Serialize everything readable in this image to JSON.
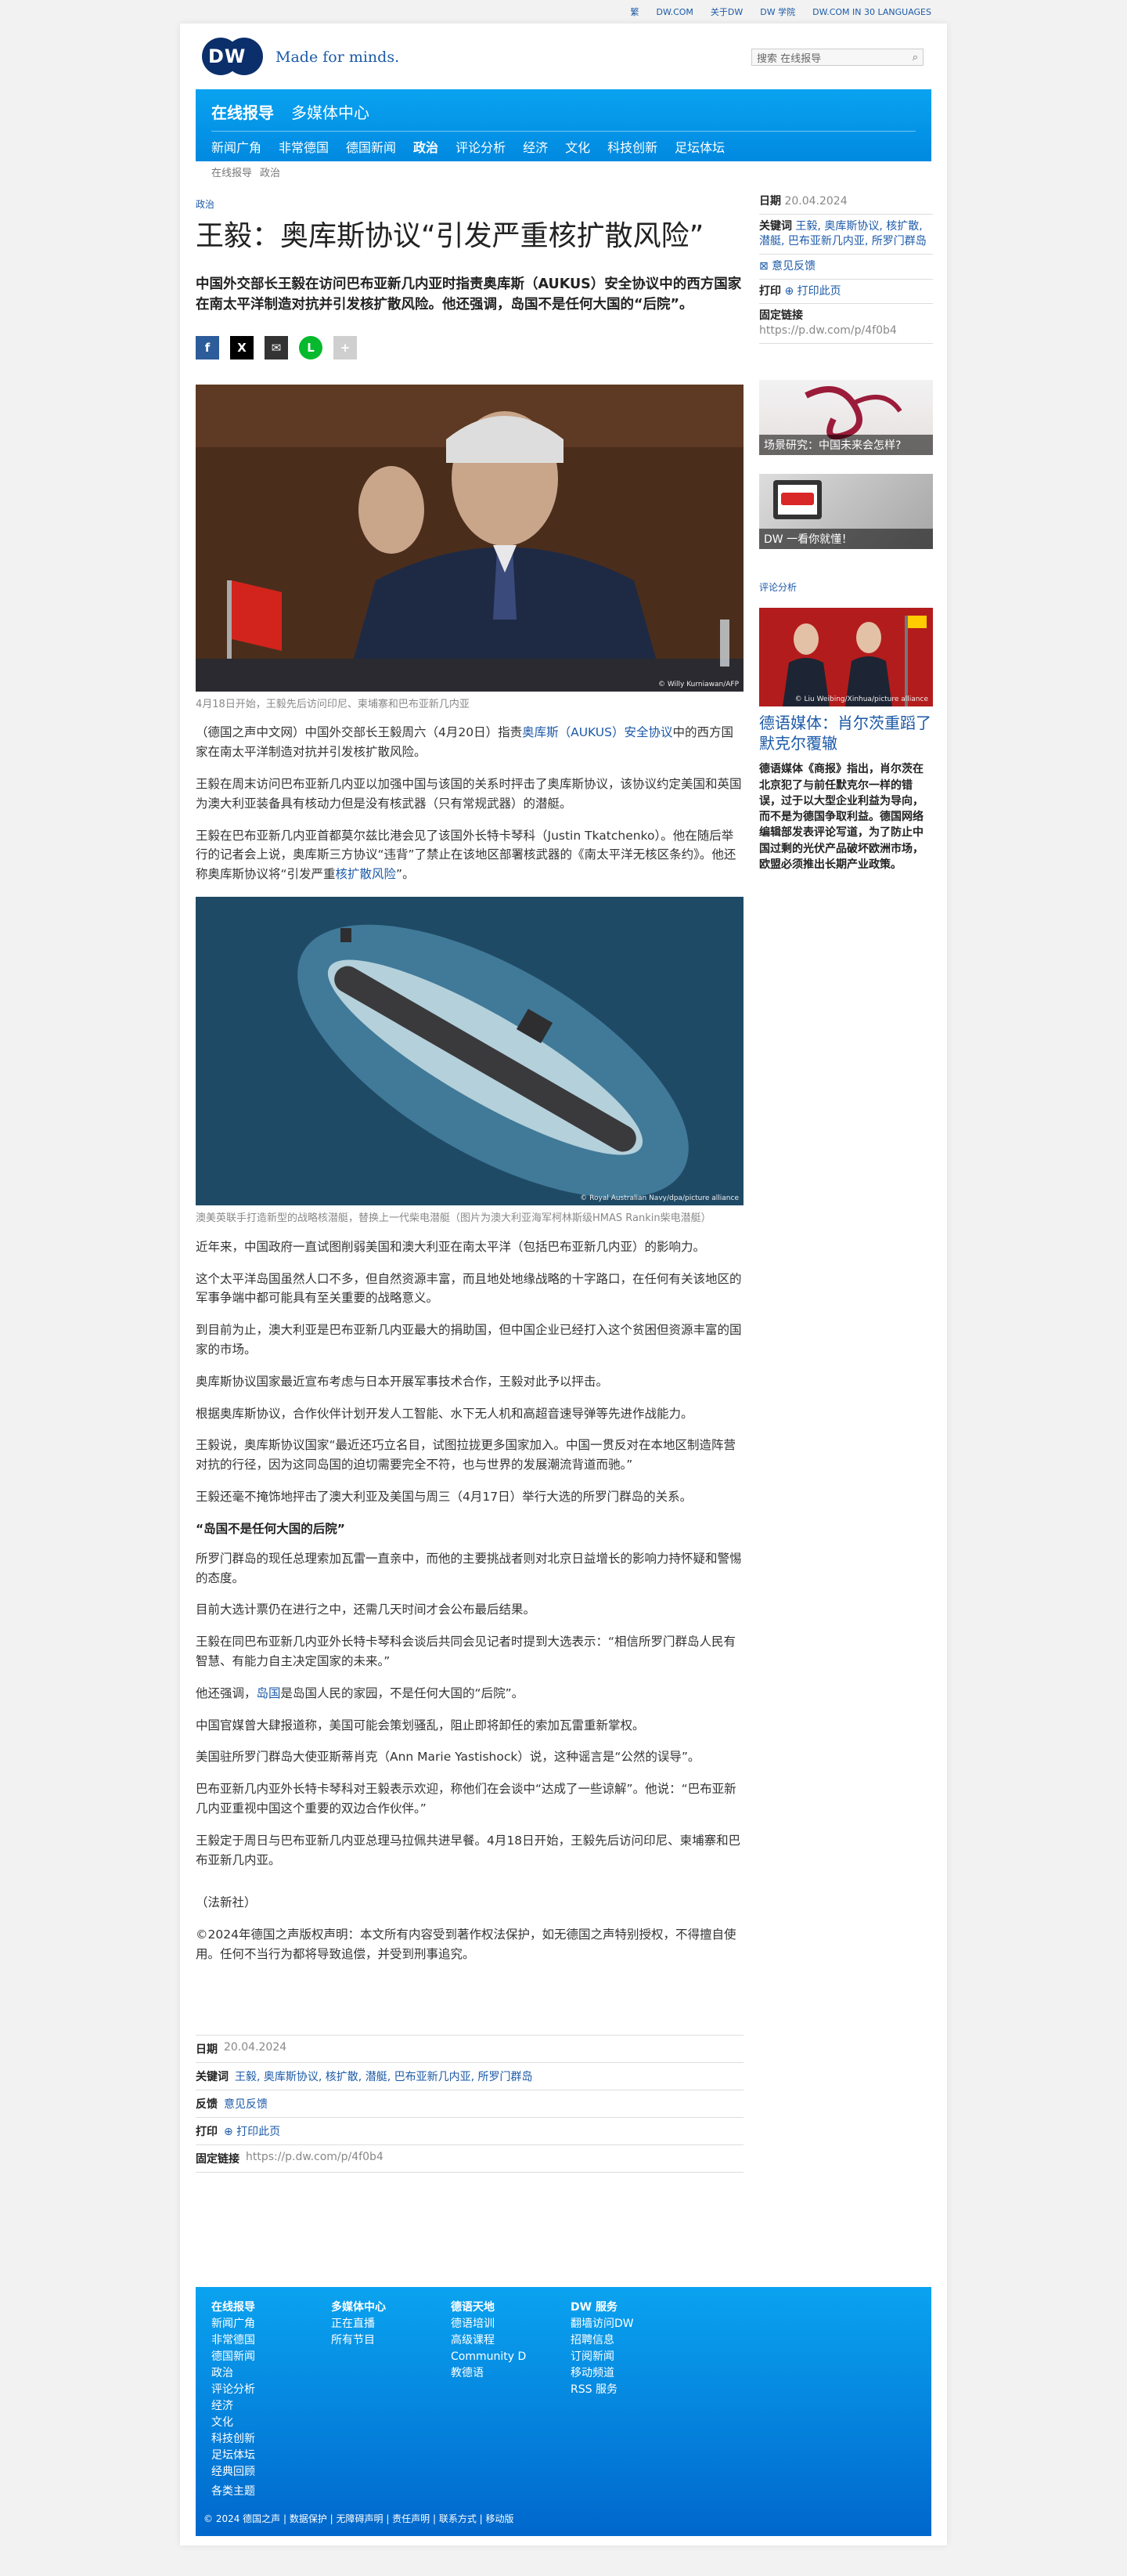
{
  "topbar": {
    "links": [
      "繁",
      "DW.COM",
      "关于DW",
      "DW 学院",
      "DW.COM IN 30 LANGUAGES"
    ]
  },
  "header": {
    "logo_text": "DW",
    "tagline": "Made for minds.",
    "search_placeholder": "搜索 在线报导"
  },
  "nav": {
    "main": [
      "在线报导",
      "多媒体中心"
    ],
    "sub": [
      "新闻广角",
      "非常德国",
      "德国新闻",
      "政治",
      "评论分析",
      "经济",
      "文化",
      "科技创新",
      "足坛体坛"
    ]
  },
  "breadcrumb": [
    "在线报导",
    "政治"
  ],
  "article": {
    "category": "政治",
    "title": "王毅：奥库斯协议“引发严重核扩散风险”",
    "lede": "中国外交部长王毅在访问巴布亚新几内亚时指责奥库斯（AUKUS）安全协议中的西方国家在南太平洋制造对抗并引发核扩散风险。他还强调，岛国不是任何大国的“后院”。",
    "share": [
      "f",
      "X",
      "✉",
      "L",
      "+"
    ],
    "image1_credit": "© Willy Kurniawan/AFP",
    "caption1": "4月18日开始，王毅先后访问印尼、柬埔寨和巴布亚新几内亚",
    "p1_a": "（德国之声中文网）中国外交部长王毅周六（4月20日）指责",
    "p1_link": "奥库斯（AUKUS）安全协议",
    "p1_b": "中的西方国家在南太平洋制造对抗并引发核扩散风险。",
    "p2": "王毅在周末访问巴布亚新几内亚以加强中国与该国的关系时抨击了奥库斯协议，该协议约定美国和英国为澳大利亚装备具有核动力但是没有核武器（只有常规武器）的潜艇。",
    "p3_a": "王毅在巴布亚新几内亚首都莫尔兹比港会见了该国外长特卡琴科（Justin Tkatchenko）。他在随后举行的记者会上说，奥库斯三方协议“违背”了禁止在该地区部署核武器的《南太平洋无核区条约》。他还称奥库斯协议将“引发严重",
    "p3_link": "核扩散风险",
    "p3_b": "”。",
    "image2_credit": "© Royal Australian Navy/dpa/picture alliance",
    "caption2": "澳美英联手打造新型的战略核潜艇，替换上一代柴电潜艇（图片为澳大利亚海军柯林斯级HMAS Rankin柴电潜艇）",
    "p4": "近年来，中国政府一直试图削弱美国和澳大利亚在南太平洋（包括巴布亚新几内亚）的影响力。",
    "p5": "这个太平洋岛国虽然人口不多，但自然资源丰富，而且地处地缘战略的十字路口，在任何有关该地区的军事争端中都可能具有至关重要的战略意义。",
    "p6": "到目前为止，澳大利亚是巴布亚新几内亚最大的捐助国，但中国企业已经打入这个贫困但资源丰富的国家的市场。",
    "p7": "奥库斯协议国家最近宣布考虑与日本开展军事技术合作，王毅对此予以抨击。",
    "p8": "根据奥库斯协议，合作伙伴计划开发人工智能、水下无人机和高超音速导弹等先进作战能力。",
    "p9": "王毅说，奥库斯协议国家“最近还巧立名目，试图拉拢更多国家加入。中国一贯反对在本地区制造阵营对抗的行径，因为这同岛国的迫切需要完全不符，也与世界的发展潮流背道而驰。”",
    "p10": "王毅还毫不掩饰地抨击了澳大利亚及美国与周三（4月17日）举行大选的所罗门群岛的关系。",
    "subhead": "“岛国不是任何大国的后院”",
    "p11": "所罗门群岛的现任总理索加瓦雷一直亲中，而他的主要挑战者则对北京日益增长的影响力持怀疑和警惕的态度。",
    "p12": "目前大选计票仍在进行之中，还需几天时间才会公布最后结果。",
    "p13": "王毅在同巴布亚新几内亚外长特卡琴科会谈后共同会见记者时提到大选表示：“相信所罗门群岛人民有智慧、有能力自主决定国家的未来。”",
    "p14_a": "他还强调，",
    "p14_link": "岛国",
    "p14_b": "是岛国人民的家园，不是任何大国的“后院”。",
    "p15": "中国官媒曾大肆报道称，美国可能会策划骚乱，阻止即将卸任的索加瓦雷重新掌权。",
    "p16": "美国驻所罗门群岛大使亚斯蒂肖克（Ann Marie Yastishock）说，这种谣言是“公然的误导”。",
    "p17": "巴布亚新几内亚外长特卡琴科对王毅表示欢迎，称他们在会谈中“达成了一些谅解”。他说：“巴布亚新几内亚重视中国这个重要的双边合作伙伴。”",
    "p18": "王毅定于周日与巴布亚新几内亚总理马拉佩共进早餐。4月18日开始，王毅先后访问印尼、柬埔寨和巴布亚新几内亚。",
    "source": "（法新社）",
    "copyright": "©2024年德国之声版权声明：本文所有内容受到著作权法保护，如无德国之声特别授权，不得擅自使用。任何不当行为都将导致追偿，并受到刑事追究。"
  },
  "meta": {
    "date_label": "日期",
    "date": "20.04.2024",
    "keywords_label": "关键词",
    "keywords": "王毅, 奥库斯协议, 核扩散, 潜艇, 巴布亚新几内亚, 所罗门群岛",
    "feedback_label": "反馈",
    "feedback": "意见反馈",
    "print_label": "打印",
    "print": "⊕ 打印此页",
    "permalink_label": "固定链接",
    "permalink": "https://p.dw.com/p/4f0b4"
  },
  "sidebar": {
    "feedback_link": "⊠ 意见反馈",
    "teaser1": "场景研究：中国未来会怎样?",
    "teaser2": "DW 一看你就懂！",
    "section": "评论分析",
    "t3_credit": "© Liu Weibing/Xinhua/picture alliance",
    "title": "德语媒体：肖尔茨重蹈了默克尔覆辙",
    "text": "德语媒体《商报》指出，肖尔茨在北京犯了与前任默克尔一样的错误，过于以大型企业利益为导向，而不是为德国争取利益。德国网络编辑部发表评论写道，为了防止中国过剩的光伏产品破坏欧洲市场，欧盟必须推出长期产业政策。"
  },
  "footer": {
    "col1_head": "在线报导",
    "col1": [
      "新闻广角",
      "非常德国",
      "德国新闻",
      "政治",
      "评论分析",
      "经济",
      "文化",
      "科技创新",
      "足坛体坛",
      "经典回顾"
    ],
    "col2_head": "多媒体中心",
    "col2": [
      "正在直播",
      "所有节目"
    ],
    "col3_head": "德语天地",
    "col3": [
      "德语培训",
      "高级课程",
      "Community D",
      "教德语"
    ],
    "col4_head": "DW 服务",
    "col4": [
      "翻墙访问DW",
      "招聘信息",
      "订阅新闻",
      "移动频道",
      "RSS 服务"
    ],
    "topics": "各类主题",
    "copyright": "© 2024 德国之声 | 数据保护 | 无障碍声明 | 责任声明 | 联系方式 | 移动版"
  },
  "colors": {
    "brand_blue": "#0aa3f0",
    "link_blue": "#1c5aa8",
    "dark_navy": "#0b2f6b"
  }
}
